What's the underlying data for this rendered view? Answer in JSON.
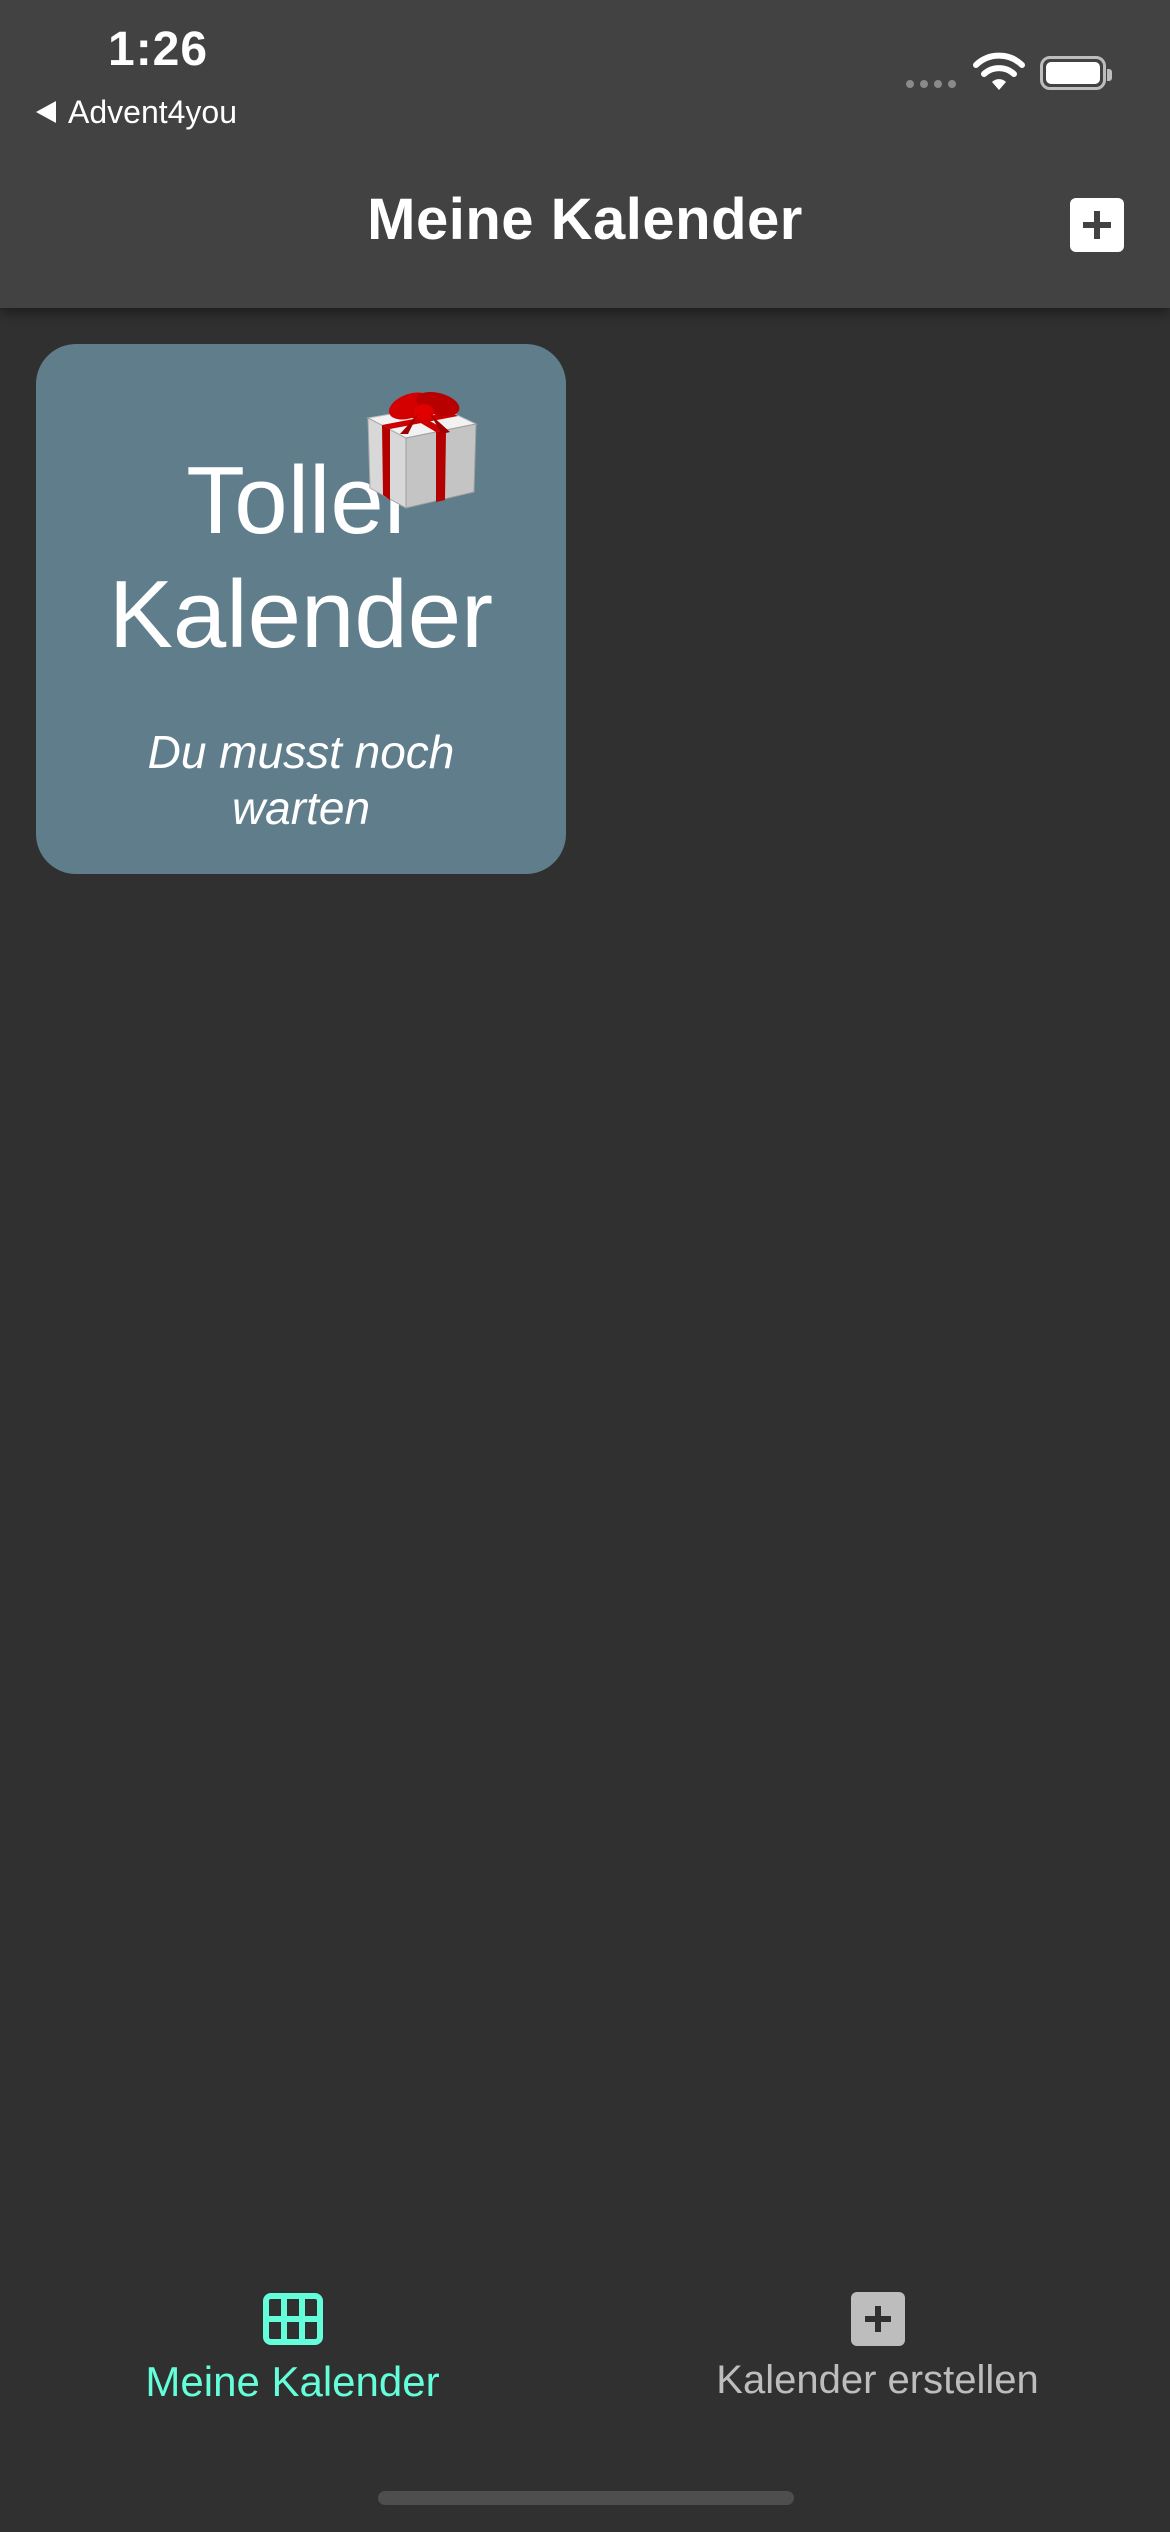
{
  "status_bar": {
    "time": "1:26",
    "back_app": "Advent4you"
  },
  "app_bar": {
    "title": "Meine Kalender",
    "add_icon": "plus-square-icon"
  },
  "calendars": [
    {
      "title": "Toller Kalender",
      "subtitle": "Du musst noch warten",
      "icon": "gift-box-icon",
      "color": "#607d8b"
    }
  ],
  "bottom_nav": {
    "items": [
      {
        "label": "Meine Kalender",
        "icon": "grid-icon",
        "active": true
      },
      {
        "label": "Kalender erstellen",
        "icon": "plus-square-icon",
        "active": false
      }
    ],
    "active_color": "#64ffda",
    "inactive_color": "#bdbdbd"
  },
  "colors": {
    "background": "#303030",
    "app_bar": "#424242",
    "card": "#607d8b",
    "accent": "#64ffda"
  }
}
